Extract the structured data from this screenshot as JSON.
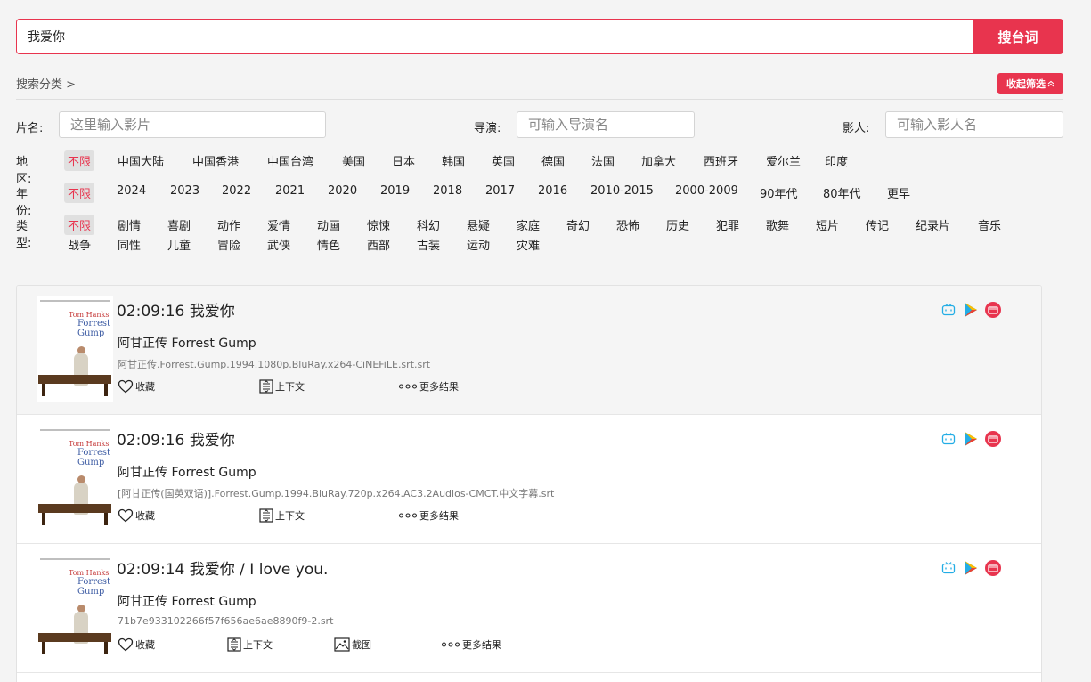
{
  "search": {
    "value": "我爱你",
    "button": "搜台词"
  },
  "category": {
    "label": "搜索分类 >",
    "collapse_label": "收起筛选"
  },
  "fields": {
    "title": {
      "label": "片名:",
      "placeholder": "这里输入影片"
    },
    "director": {
      "label": "导演:",
      "placeholder": "可输入导演名"
    },
    "actor": {
      "label": "影人:",
      "placeholder": "可输入影人名"
    }
  },
  "filters": {
    "region": {
      "label": "地区:",
      "options": [
        "不限",
        "中国大陆",
        "中国香港",
        "中国台湾",
        "美国",
        "日本",
        "韩国",
        "英国",
        "德国",
        "法国",
        "加拿大",
        "西班牙",
        "爱尔兰",
        "印度"
      ]
    },
    "year": {
      "label": "年份:",
      "options": [
        "不限",
        "2024",
        "2023",
        "2022",
        "2021",
        "2020",
        "2019",
        "2018",
        "2017",
        "2016",
        "2010-2015",
        "2000-2009",
        "90年代",
        "80年代",
        "更早"
      ]
    },
    "genre": {
      "label": "类型:",
      "options": [
        "不限",
        "剧情",
        "喜剧",
        "动作",
        "爱情",
        "动画",
        "惊悚",
        "科幻",
        "悬疑",
        "家庭",
        "奇幻",
        "恐怖",
        "历史",
        "犯罪",
        "歌舞",
        "短片",
        "传记",
        "纪录片",
        "音乐",
        "战争",
        "同性",
        "儿童",
        "冒险",
        "武侠",
        "情色",
        "西部",
        "古装",
        "运动",
        "灾难"
      ]
    }
  },
  "poster_text": {
    "line1": "Tom Hanks",
    "line2": "Forrest",
    "line3": "Gump"
  },
  "actions": {
    "favorite": "收藏",
    "context": "上下文",
    "screenshot": "截图",
    "more": "更多结果"
  },
  "results": [
    {
      "time": "02:09:16",
      "quote": "我爱你",
      "movie": "阿甘正传 Forrest Gump",
      "file": "阿甘正传.Forrest.Gump.1994.1080p.BluRay.x264-CiNEFiLE.srt.srt",
      "has_screenshot": false
    },
    {
      "time": "02:09:16",
      "quote": "我爱你",
      "movie": "阿甘正传 Forrest Gump",
      "file": "[阿甘正传(国英双语)].Forrest.Gump.1994.BluRay.720p.x264.AC3.2Audios-CMCT.中文字幕.srt",
      "has_screenshot": false
    },
    {
      "time": "02:09:14",
      "quote": "我爱你 / I love you.",
      "movie": "阿甘正传 Forrest Gump",
      "file": "71b7e933102266f57f656ae6ae8890f9-2.srt",
      "has_screenshot": true
    }
  ],
  "colors": {
    "accent": "#e8344e",
    "bilibili": "#23ade5",
    "play": "#1fa463",
    "video": "#e8344e"
  },
  "icons": [
    "tv-icon",
    "play-icon",
    "video-icon"
  ]
}
